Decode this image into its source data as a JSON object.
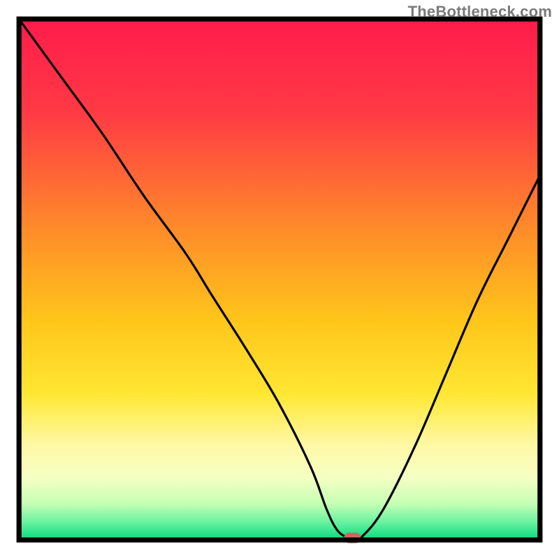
{
  "attribution": "TheBottleneck.com",
  "chart_data": {
    "type": "line",
    "title": "",
    "xlabel": "",
    "ylabel": "",
    "xlim": [
      0,
      100
    ],
    "ylim": [
      0,
      100
    ],
    "axes_visible": false,
    "gradient_stops": [
      {
        "offset": 0.0,
        "color": "#ff1b4b"
      },
      {
        "offset": 0.18,
        "color": "#ff3a44"
      },
      {
        "offset": 0.4,
        "color": "#ff8a2a"
      },
      {
        "offset": 0.58,
        "color": "#ffc61a"
      },
      {
        "offset": 0.72,
        "color": "#ffe733"
      },
      {
        "offset": 0.82,
        "color": "#fff9a8"
      },
      {
        "offset": 0.88,
        "color": "#f6ffc3"
      },
      {
        "offset": 0.93,
        "color": "#c6ffb5"
      },
      {
        "offset": 0.965,
        "color": "#6cf2a0"
      },
      {
        "offset": 0.985,
        "color": "#2fe58c"
      },
      {
        "offset": 1.0,
        "color": "#12d47a"
      }
    ],
    "series": [
      {
        "name": "bottleneck-curve",
        "x": [
          0,
          8,
          16,
          24,
          32,
          37,
          44,
          50,
          56,
          59,
          61,
          63,
          64.5,
          66,
          70,
          76,
          82,
          88,
          94,
          100
        ],
        "y": [
          100,
          89,
          78,
          66,
          55,
          47,
          36,
          26,
          14,
          6,
          2,
          0.5,
          0.4,
          0.8,
          6,
          18,
          32,
          46,
          58,
          70
        ]
      }
    ],
    "marker": {
      "name": "bottleneck-marker",
      "x": 64,
      "y": 0.4,
      "color": "#c9685d"
    },
    "frame": {
      "x": 3.4,
      "y": 3.4,
      "width": 93.2,
      "height": 93.2,
      "stroke_width": 0.9,
      "stroke": "#000000"
    }
  }
}
